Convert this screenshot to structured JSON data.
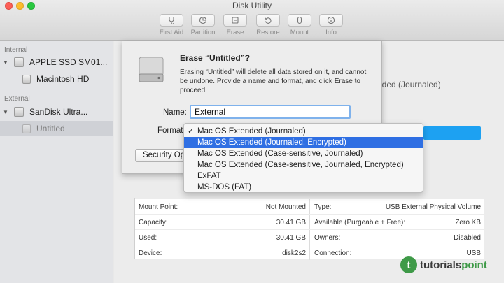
{
  "window": {
    "title": "Disk Utility"
  },
  "toolbar": [
    {
      "label": "First Aid",
      "icon": "stethoscope-icon"
    },
    {
      "label": "Partition",
      "icon": "pie-partition-icon"
    },
    {
      "label": "Erase",
      "icon": "erase-icon"
    },
    {
      "label": "Restore",
      "icon": "restore-icon"
    },
    {
      "label": "Mount",
      "icon": "mount-icon"
    },
    {
      "label": "Info",
      "icon": "info-icon"
    }
  ],
  "sidebar": {
    "internal_header": "Internal",
    "external_header": "External",
    "items": [
      {
        "label": "APPLE SSD SM01..."
      },
      {
        "label": "Macintosh HD"
      },
      {
        "label": "SanDisk Ultra..."
      },
      {
        "label": "Untitled"
      }
    ]
  },
  "main": {
    "partial_format_text": "nded (Journaled)",
    "info": {
      "left": [
        {
          "label": "Mount Point:",
          "value": "Not Mounted"
        },
        {
          "label": "Capacity:",
          "value": "30.41 GB"
        },
        {
          "label": "Used:",
          "value": "30.41 GB"
        },
        {
          "label": "Device:",
          "value": "disk2s2"
        }
      ],
      "right": [
        {
          "label": "Type:",
          "value": "USB External Physical Volume"
        },
        {
          "label": "Available (Purgeable + Free):",
          "value": "Zero KB"
        },
        {
          "label": "Owners:",
          "value": "Disabled"
        },
        {
          "label": "Connection:",
          "value": "USB"
        }
      ]
    }
  },
  "sheet": {
    "title": "Erase “Untitled”?",
    "description": "Erasing “Untitled” will delete all data stored on it, and cannot be undone. Provide a name and format, and click Erase to proceed.",
    "name_label": "Name:",
    "name_value": "External",
    "format_label": "Format",
    "security_button": "Security Op"
  },
  "format_menu": {
    "check_mark": "✓",
    "items": [
      {
        "label": "Mac OS Extended (Journaled)",
        "checked": true
      },
      {
        "label": "Mac OS Extended (Journaled, Encrypted)",
        "highlighted": true
      },
      {
        "label": "Mac OS Extended (Case-sensitive, Journaled)"
      },
      {
        "label": "Mac OS Extended (Case-sensitive, Journaled, Encrypted)"
      },
      {
        "label": "ExFAT"
      },
      {
        "label": "MS-DOS (FAT)"
      }
    ]
  },
  "watermark": {
    "mark": "t",
    "prefix": "tutorials",
    "suffix": "point"
  },
  "colors": {
    "highlight": "#2f6fe3",
    "accent_bar": "#1da1f2",
    "brand": "#3f9a48"
  }
}
